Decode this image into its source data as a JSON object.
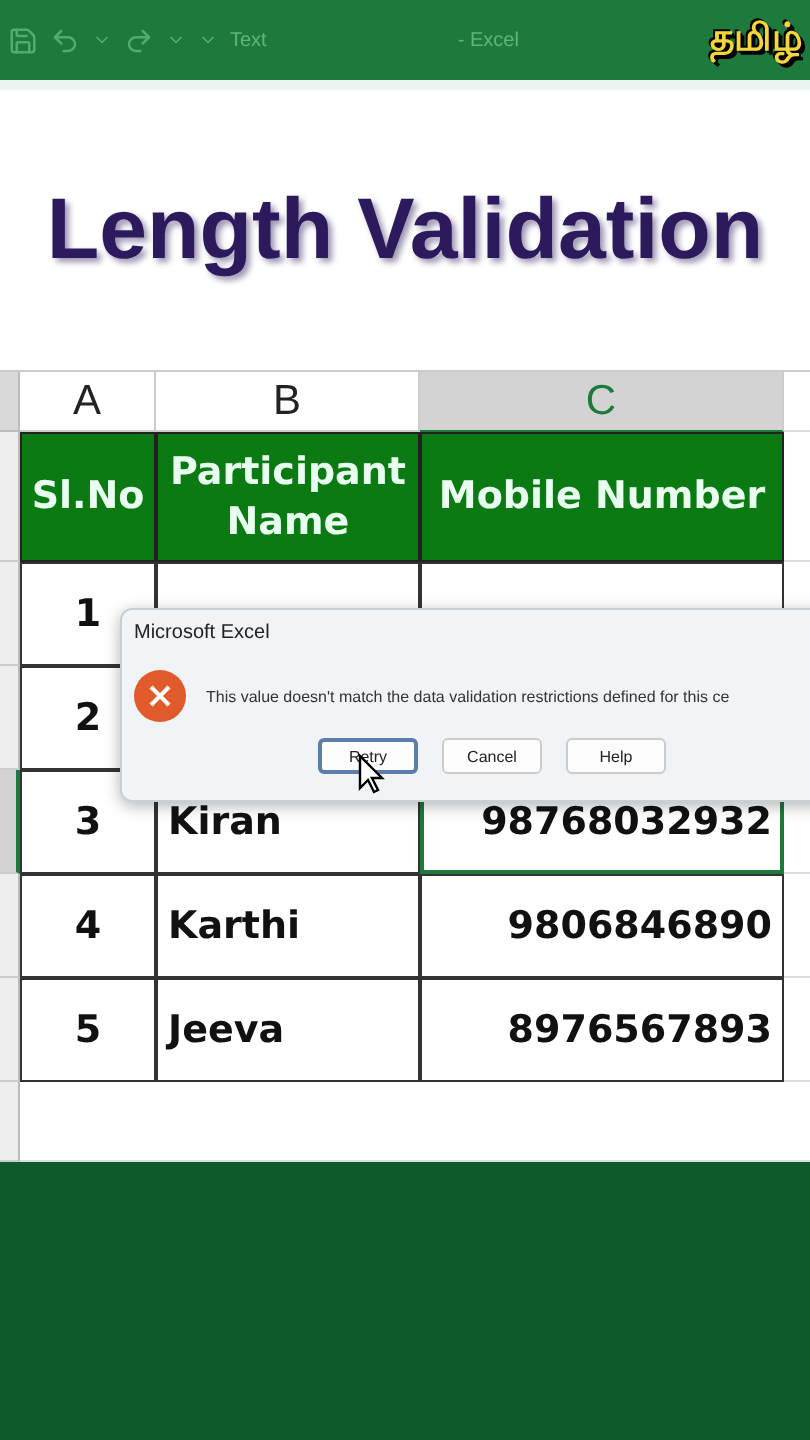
{
  "title_bar": {
    "document": "Text",
    "app": "- Excel",
    "language_badge": "தமிழ்"
  },
  "headline": "Length Validation",
  "sheet": {
    "columns": [
      {
        "letter": "A",
        "selected": false
      },
      {
        "letter": "B",
        "selected": false
      },
      {
        "letter": "C",
        "selected": true
      }
    ],
    "header": [
      "Sl.No",
      "Participant Name",
      "Mobile Number"
    ],
    "rows": [
      {
        "sl": "1",
        "selected": false
      },
      {
        "sl": "2",
        "selected": false
      },
      {
        "sl": "3",
        "name": "Kiran",
        "mobile": "98768032932",
        "selected": true
      },
      {
        "sl": "4",
        "name": "Karthi",
        "mobile": "9806846890",
        "selected": false
      },
      {
        "sl": "5",
        "name": "Jeeva",
        "mobile": "8976567893",
        "selected": false
      }
    ]
  },
  "dialog": {
    "title": "Microsoft Excel",
    "message": "This value doesn't match the data validation restrictions defined for this ce",
    "buttons": [
      {
        "label": "Retry",
        "focused": true
      },
      {
        "label": "Cancel",
        "focused": false
      },
      {
        "label": "Help",
        "focused": false
      }
    ]
  }
}
